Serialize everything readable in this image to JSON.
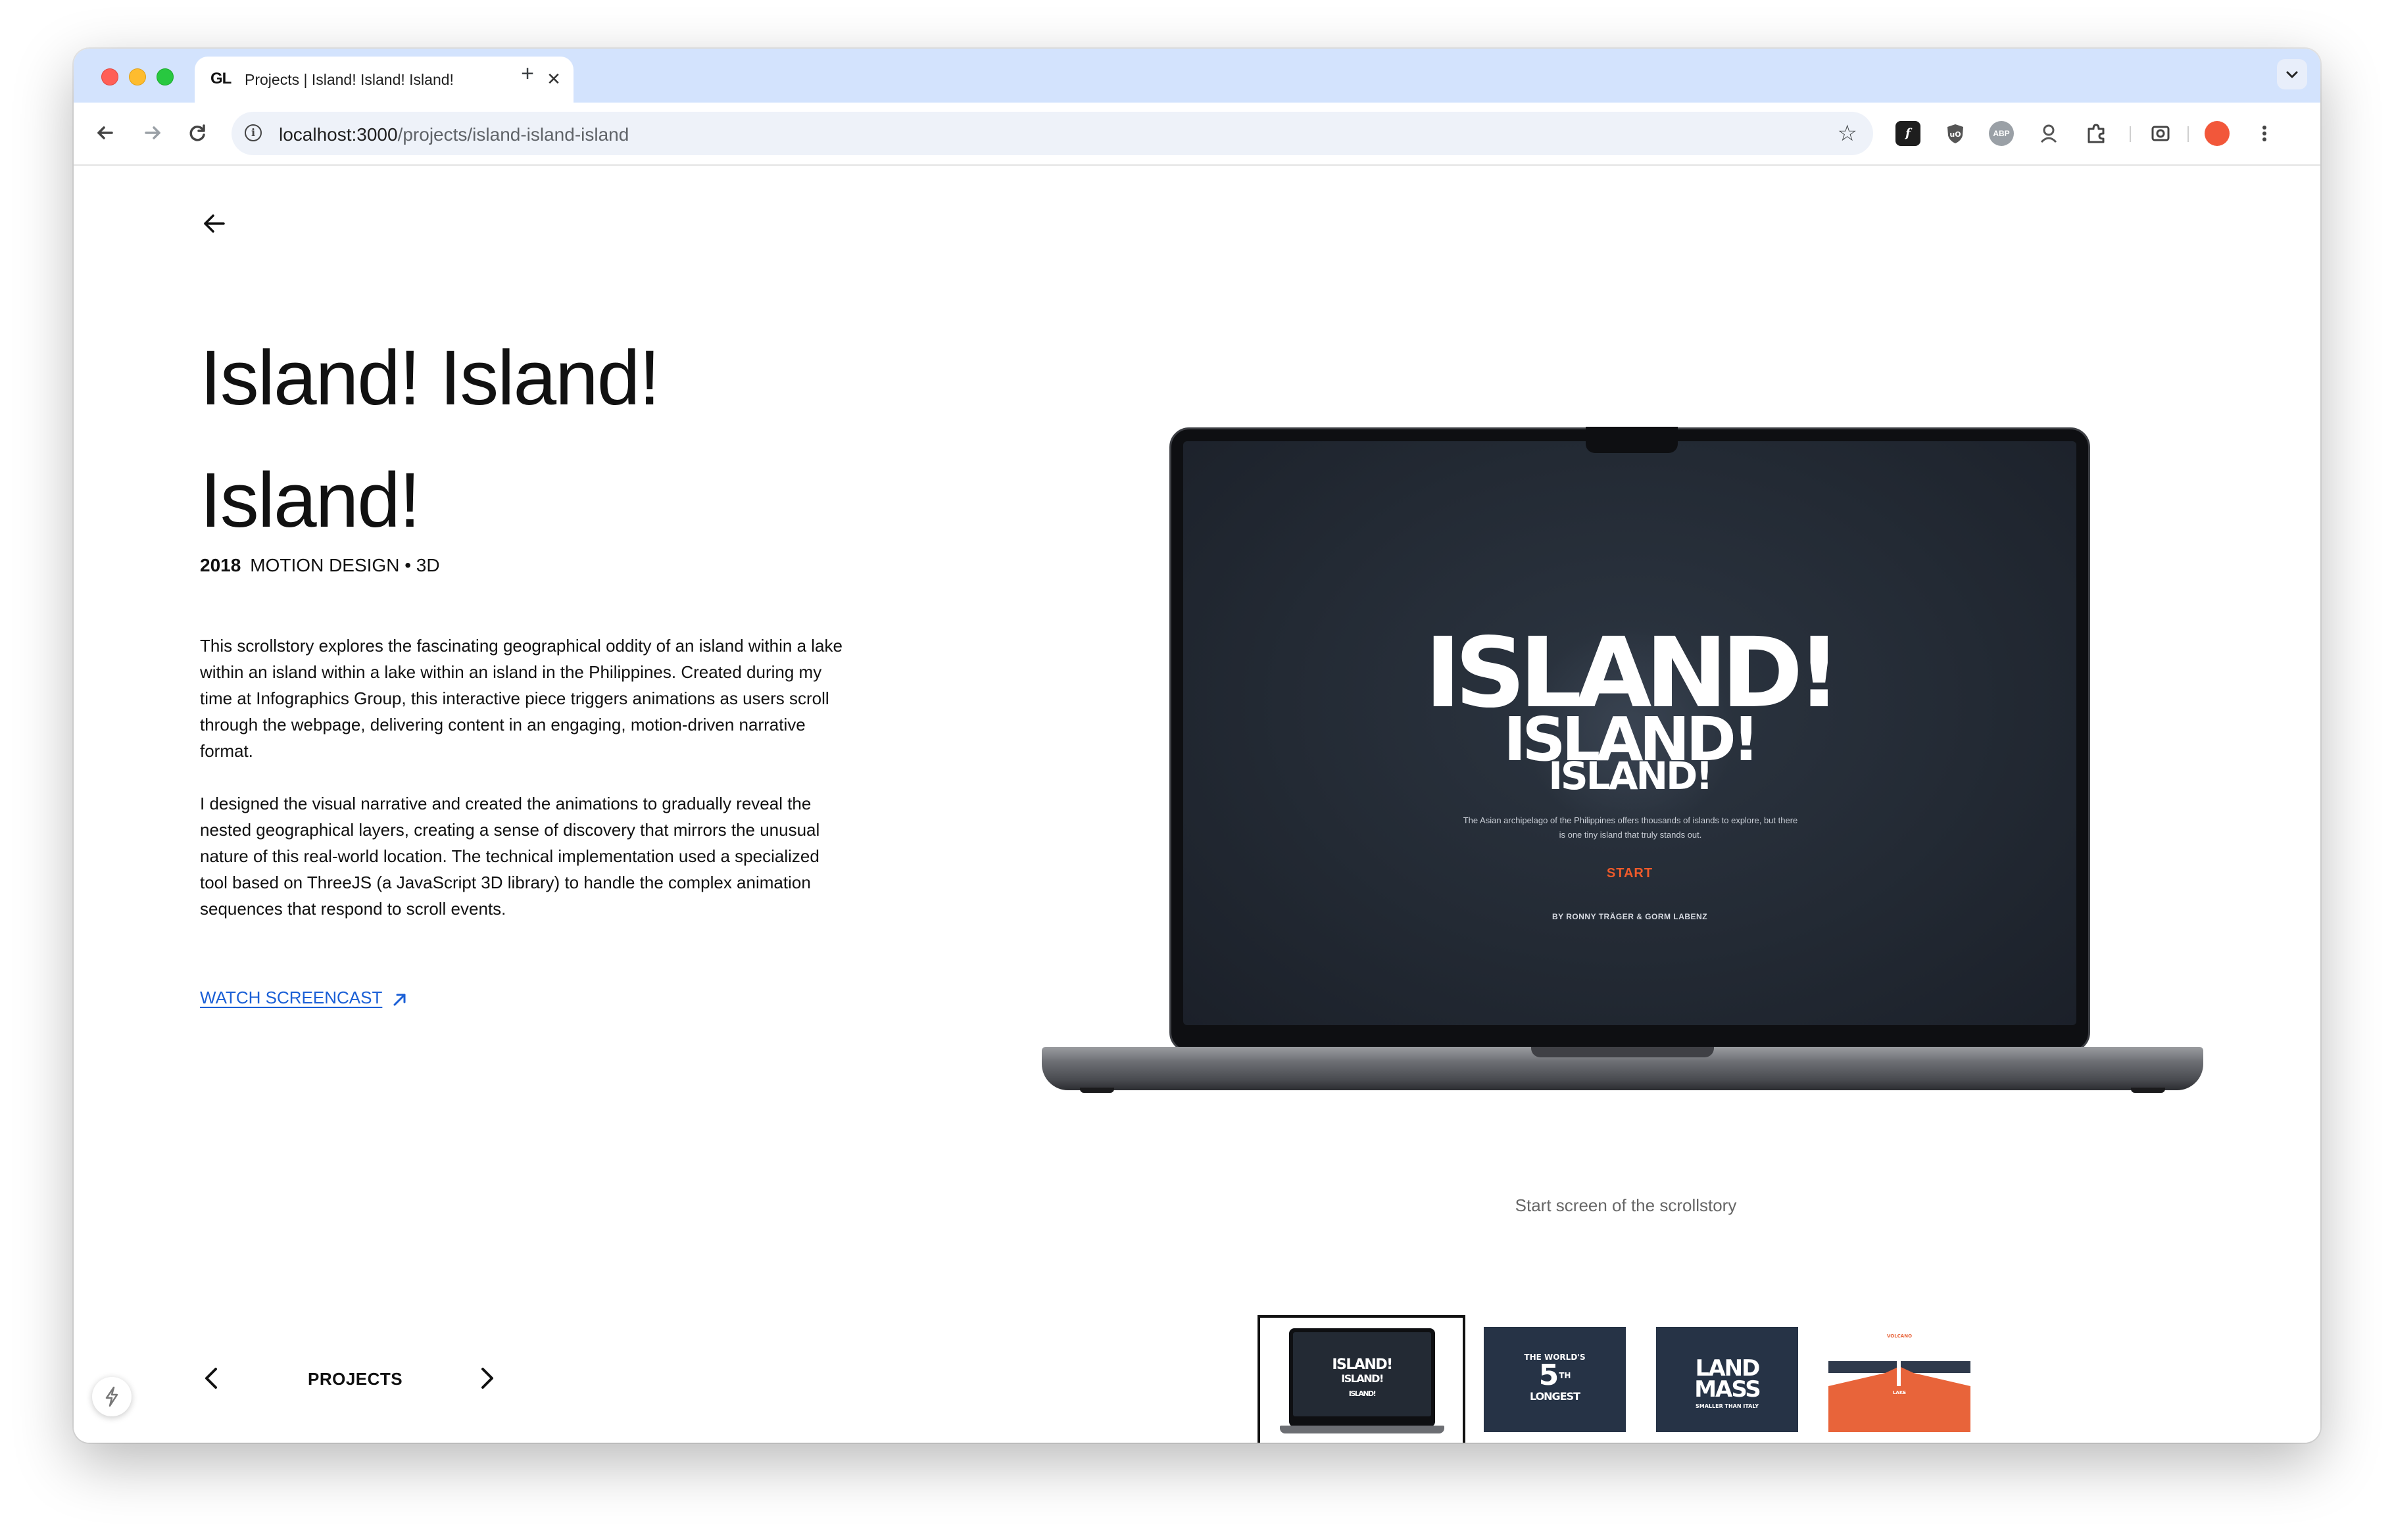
{
  "browser": {
    "tab": {
      "favicon_text": "GL",
      "title": "Projects | Island! Island! Island!",
      "close": "✕"
    },
    "new_tab": "+",
    "url_host": "localhost:3000",
    "url_path": "/projects/island-island-island",
    "extensions": [
      "f-icon",
      "ublock-icon",
      "adblock-plus-icon",
      "puzzle-person-icon",
      "extensions-puzzle-icon",
      "screenshot-icon",
      "profile-avatar-icon"
    ]
  },
  "project": {
    "title_line1": "Island! Island!",
    "title_line2": "Island!",
    "year": "2018",
    "categories": "MOTION DESIGN • 3D",
    "paragraph1": "This scrollstory explores the fascinating geographical oddity of an island within a lake within an island within a lake within an island in the Philippines. Created during my time at Infographics Group, this interactive piece triggers animations as users scroll through the webpage, delivering content in an engaging, motion-driven narrative format.",
    "paragraph2": "I designed the visual narrative and created the animations to gradually reveal the nested geographical layers, creating a sense of discovery that mirrors the unusual nature of this real-world location. The technical implementation used a specialized tool based on ThreeJS (a JavaScript 3D library) to handle the complex animation sequences that respond to scroll events.",
    "screencast_link": "WATCH SCREENCAST"
  },
  "preview": {
    "hero_line1": "ISLAND!",
    "hero_line2": "ISLAND!",
    "hero_line3": "ISLAND!",
    "hero_subtitle": "The Asian archipelago of the Philippines offers thousands of islands to explore, but there is one tiny island that truly stands out.",
    "start_label": "START",
    "byline": "BY RONNY TRÄGER & GORM LABENZ",
    "caption": "Start screen of the scrollstory"
  },
  "thumbnails": [
    {
      "label": "ISLAND! ISLAND! ISLAND!",
      "selected": true
    },
    {
      "label": "THE WORLD'S 5TH LONGEST",
      "selected": false
    },
    {
      "label": "LAND MASS",
      "selected": false
    },
    {
      "label": "VOLCANO LAKE",
      "selected": false
    }
  ],
  "bottom_nav": {
    "label": "PROJECTS"
  },
  "colors": {
    "tab_strip": "#d3e3fd",
    "link": "#1a5fd6",
    "start_accent": "#ef5a2a",
    "slide_navy": "#263346",
    "slide_orange": "#e8643a"
  }
}
